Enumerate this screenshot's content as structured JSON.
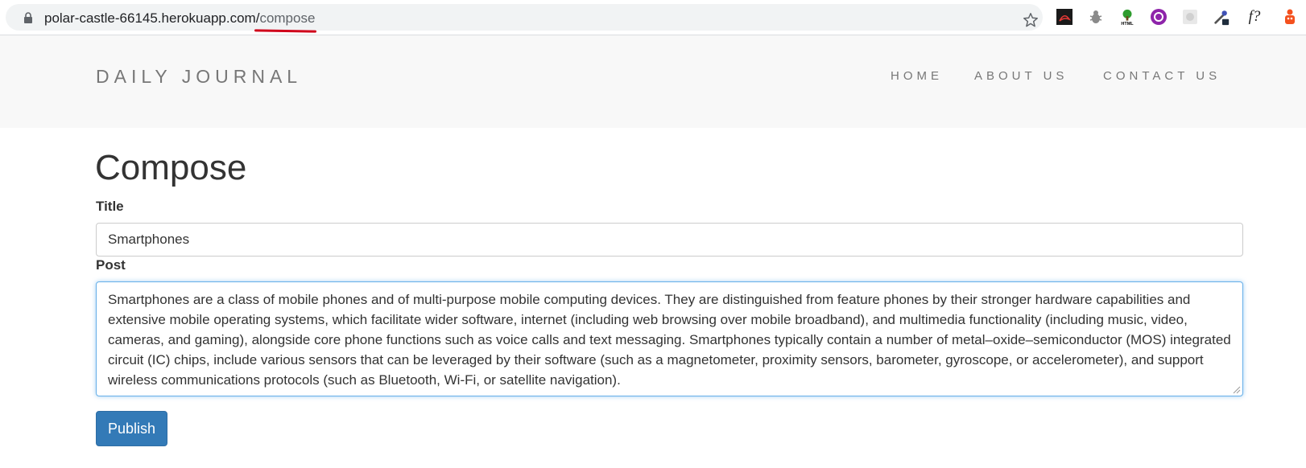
{
  "browser": {
    "url_host": "polar-castle-66145.herokuapp.com/",
    "url_path": "compose",
    "extensions": [
      "pdf-icon",
      "bug-icon",
      "html-tree-icon",
      "purple-circle-icon",
      "grey-square-icon",
      "eyedropper-icon",
      "font-f-icon",
      "orange-figure-icon"
    ],
    "font_ext_label": "f?"
  },
  "header": {
    "brand": "DAILY JOURNAL",
    "nav": [
      "HOME",
      "ABOUT US",
      "CONTACT US"
    ]
  },
  "page": {
    "heading": "Compose",
    "title_label": "Title",
    "title_value": "Smartphones",
    "post_label": "Post",
    "post_value": "Smartphones are a class of mobile phones and of multi-purpose mobile computing devices. They are distinguished from feature phones by their stronger hardware capabilities and extensive mobile operating systems, which facilitate wider software, internet (including web browsing over mobile broadband), and multimedia functionality (including music, video, cameras, and gaming), alongside core phone functions such as voice calls and text messaging. Smartphones typically contain a number of metal–oxide–semiconductor (MOS) integrated circuit (IC) chips, include various sensors that can be leveraged by their software (such as a magnetometer, proximity sensors, barometer, gyroscope, or accelerometer), and support wireless communications protocols (such as Bluetooth, Wi-Fi, or satellite navigation).",
    "publish_label": "Publish"
  },
  "colors": {
    "accent": "#337ab7",
    "focus": "#66afe9",
    "header_bg": "#f8f8f8"
  }
}
